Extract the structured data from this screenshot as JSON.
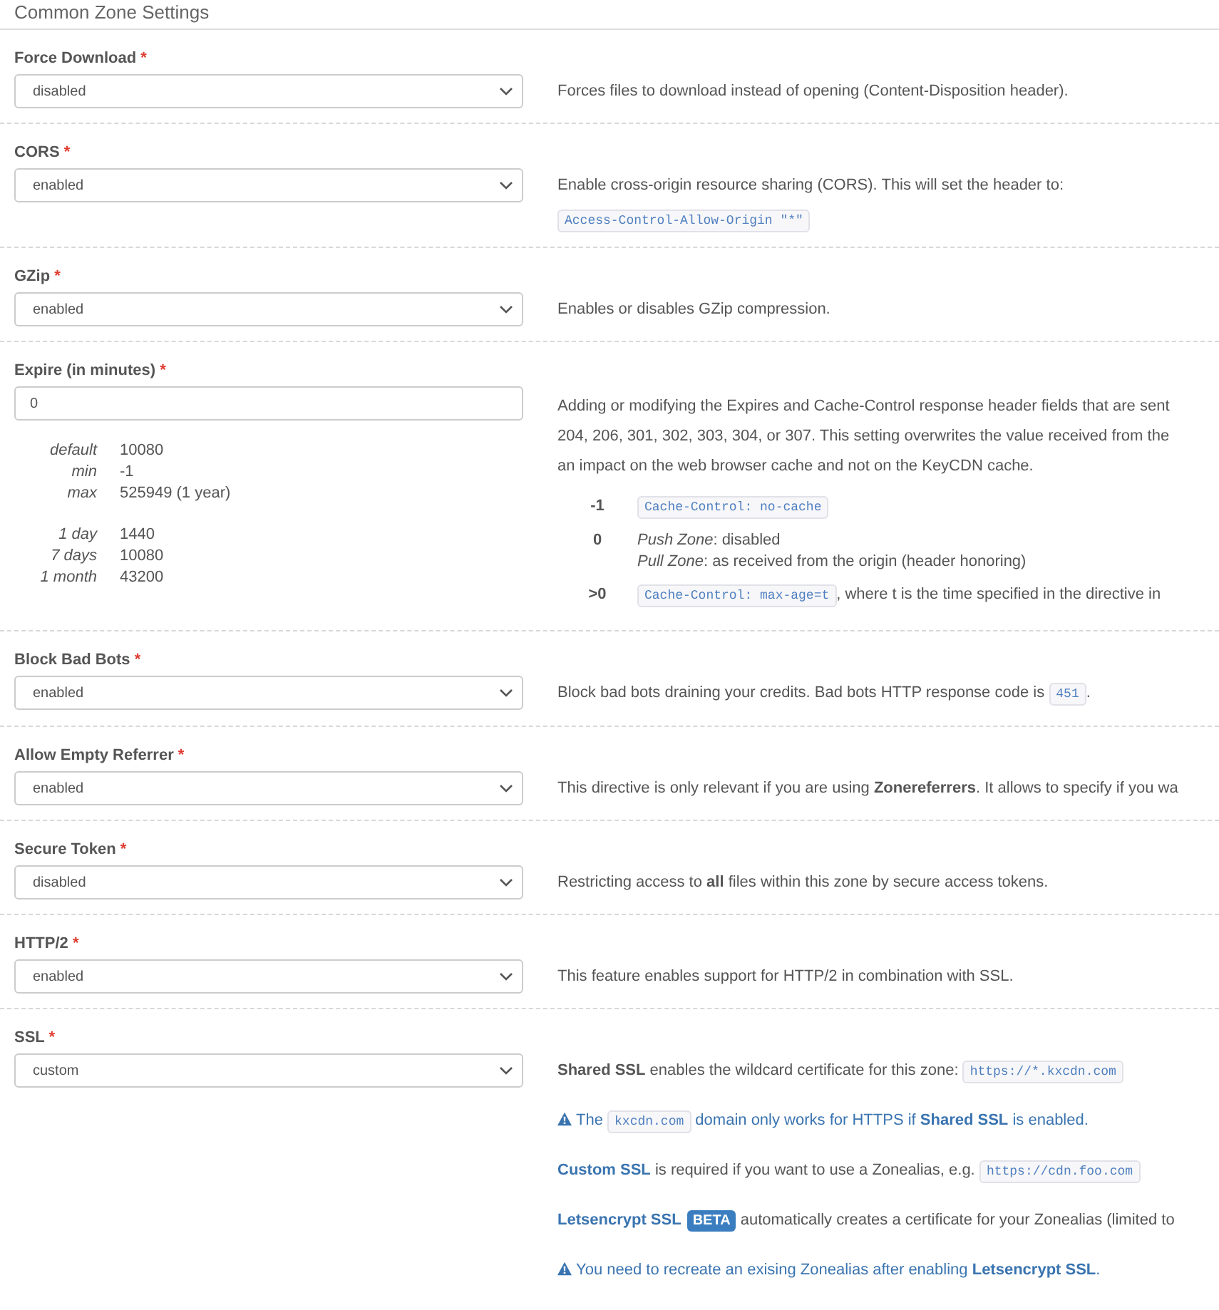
{
  "panel": {
    "title": "Common Zone Settings"
  },
  "settings": [
    {
      "label": "Force Download",
      "required_mark": "*",
      "control": {
        "kind": "select",
        "value": "disabled"
      },
      "description": [
        {
          "kind": "plain",
          "segments": [
            {
              "kind": "text",
              "text": "Forces files to download instead of opening (Content-Disposition header)."
            }
          ]
        }
      ]
    },
    {
      "label": "CORS",
      "required_mark": "*",
      "control": {
        "kind": "select",
        "value": "enabled"
      },
      "description": [
        {
          "kind": "plain",
          "segments": [
            {
              "kind": "text",
              "text": "Enable cross-origin resource sharing (CORS). This will set the header to:"
            }
          ]
        },
        {
          "kind": "tight",
          "segments": [
            {
              "kind": "code",
              "text": "Access-Control-Allow-Origin \"*\""
            }
          ]
        }
      ]
    },
    {
      "label": "GZip",
      "required_mark": "*",
      "control": {
        "kind": "select",
        "value": "enabled"
      },
      "description": [
        {
          "kind": "plain",
          "segments": [
            {
              "kind": "text",
              "text": "Enables or disables GZip compression."
            }
          ]
        }
      ]
    },
    {
      "label": "Expire (in minutes)",
      "required_mark": "*",
      "control": {
        "kind": "input",
        "value": "0"
      },
      "limits": [
        [
          {
            "key": "default",
            "value": "10080"
          },
          {
            "key": "min",
            "value": "-1"
          },
          {
            "key": "max",
            "value": "525949 (1 year)"
          }
        ],
        [
          {
            "key": "1 day",
            "value": "1440"
          },
          {
            "key": "7 days",
            "value": "10080"
          },
          {
            "key": "1 month",
            "value": "43200"
          }
        ]
      ],
      "description": [
        {
          "kind": "lines",
          "lines": [
            "Adding or modifying the Expires and Cache-Control response header fields that are sent",
            "204, 206, 301, 302, 303, 304, or 307. This setting overwrites the value received from the",
            "an impact on the web browser cache and not on the KeyCDN cache."
          ]
        }
      ],
      "values": [
        {
          "key": "-1",
          "lines": [
            [
              {
                "kind": "code",
                "text": "Cache-Control: no-cache"
              }
            ]
          ]
        },
        {
          "key": "0",
          "lines": [
            [
              {
                "kind": "text",
                "text": "*Push Zone*: disabled"
              }
            ],
            [
              {
                "kind": "text",
                "text": "*Pull Zone*: as received from the origin (header honoring)"
              }
            ]
          ]
        },
        {
          "key": ">0",
          "lines": [
            [
              {
                "kind": "code",
                "text": "Cache-Control: max-age=t"
              },
              {
                "kind": "text",
                "text": ", where t is the time specified in the directive in"
              }
            ]
          ]
        }
      ]
    },
    {
      "label": "Block Bad Bots",
      "required_mark": "*",
      "control": {
        "kind": "select",
        "value": "enabled"
      },
      "description": [
        {
          "kind": "plain",
          "segments": [
            {
              "kind": "text",
              "text": "Block bad bots draining your credits. Bad bots HTTP response code is "
            },
            {
              "kind": "code",
              "text": "451"
            },
            {
              "kind": "text",
              "text": "."
            }
          ]
        }
      ]
    },
    {
      "label": "Allow Empty Referrer",
      "required_mark": "*",
      "control": {
        "kind": "select",
        "value": "enabled"
      },
      "description": [
        {
          "kind": "plain",
          "segments": [
            {
              "kind": "text",
              "text": "This directive is only relevant if you are using **Zonereferrers**. It allows to specify if you wa"
            }
          ]
        }
      ]
    },
    {
      "label": "Secure Token",
      "required_mark": "*",
      "control": {
        "kind": "select",
        "value": "disabled"
      },
      "description": [
        {
          "kind": "plain",
          "segments": [
            {
              "kind": "text",
              "text": "Restricting access to **all** files within this zone by secure access tokens."
            }
          ]
        }
      ]
    },
    {
      "label": "HTTP/2",
      "required_mark": "*",
      "control": {
        "kind": "select",
        "value": "enabled"
      },
      "description": [
        {
          "kind": "plain",
          "segments": [
            {
              "kind": "text",
              "text": "This feature enables support for HTTP/2 in combination with SSL."
            }
          ]
        }
      ]
    },
    {
      "label": "SSL",
      "required_mark": "*",
      "control": {
        "kind": "select",
        "value": "custom"
      },
      "description": [
        {
          "kind": "plain",
          "segments": [
            {
              "kind": "strong",
              "text": "Shared SSL"
            },
            {
              "kind": "text",
              "text": " enables the wildcard certificate for this zone: "
            },
            {
              "kind": "code",
              "text": "https://*.kxcdn.com"
            }
          ]
        },
        {
          "kind": "warning",
          "segments": [
            {
              "kind": "text",
              "text": "The "
            },
            {
              "kind": "code",
              "text": "kxcdn.com"
            },
            {
              "kind": "text",
              "text": " domain only works for HTTPS if "
            },
            {
              "kind": "strong",
              "text": "Shared SSL"
            },
            {
              "kind": "text",
              "text": " is enabled."
            }
          ]
        },
        {
          "kind": "plain",
          "segments": [
            {
              "kind": "accent",
              "text": "Custom SSL"
            },
            {
              "kind": "text",
              "text": " is required if you want to use a Zonealias, e.g. "
            },
            {
              "kind": "code",
              "text": "https://cdn.foo.com"
            }
          ]
        },
        {
          "kind": "plain",
          "segments": [
            {
              "kind": "accent",
              "text": "Letsencrypt SSL"
            },
            {
              "kind": "badge",
              "text": "BETA"
            },
            {
              "kind": "text",
              "text": " automatically creates a certificate for your Zonealias (limited to"
            }
          ]
        },
        {
          "kind": "warning",
          "segments": [
            {
              "kind": "text",
              "text": "You need to recreate an exising Zonealias after enabling "
            },
            {
              "kind": "strong",
              "text": "Letsencrypt SSL"
            },
            {
              "kind": "text",
              "text": "."
            }
          ]
        }
      ]
    }
  ]
}
